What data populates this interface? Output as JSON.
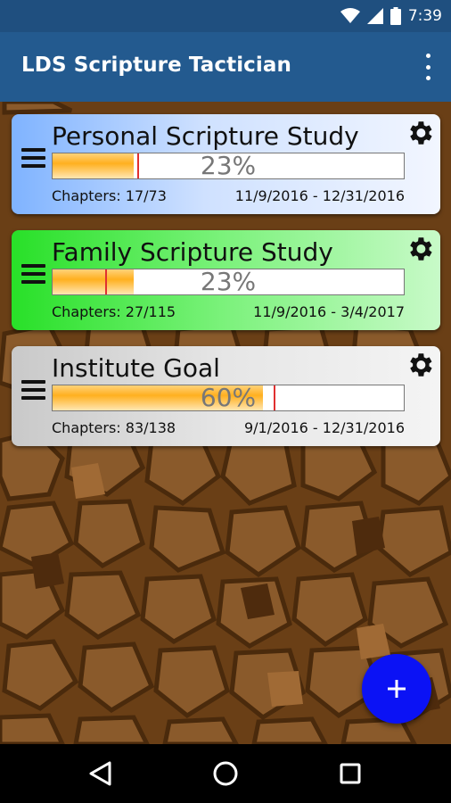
{
  "status_bar": {
    "time": "7:39",
    "icons": [
      "wifi-icon",
      "signal-icon",
      "battery-icon"
    ]
  },
  "app_bar": {
    "title": "LDS Scripture Tactician",
    "menu_icon": "more-vert-icon"
  },
  "colors": {
    "status_bar": "#1f4f7f",
    "app_bar": "#235a8f",
    "fab": "#0b12f5",
    "progress_fill": "#ffb01f",
    "marker": "#e03030"
  },
  "goals": [
    {
      "title": "Personal Scripture Study",
      "percent_label": "23%",
      "progress": 0.23,
      "expected": 0.24,
      "chapters": "Chapters: 17/73",
      "dates": "11/9/2016 - 12/31/2016",
      "color": "#7fb3ff"
    },
    {
      "title": "Family Scripture Study",
      "percent_label": "23%",
      "progress": 0.23,
      "expected": 0.15,
      "chapters": "Chapters: 27/115",
      "dates": "11/9/2016 - 3/4/2017",
      "color": "#28e028"
    },
    {
      "title": "Institute Goal",
      "percent_label": "60%",
      "progress": 0.6,
      "expected": 0.63,
      "chapters": "Chapters: 83/138",
      "dates": "9/1/2016 - 12/31/2016",
      "color": "#c9c9c9"
    }
  ],
  "fab": {
    "icon": "add-icon",
    "label": "+"
  },
  "nav_bar": {
    "icons": [
      "back-icon",
      "home-icon",
      "recents-icon"
    ]
  }
}
